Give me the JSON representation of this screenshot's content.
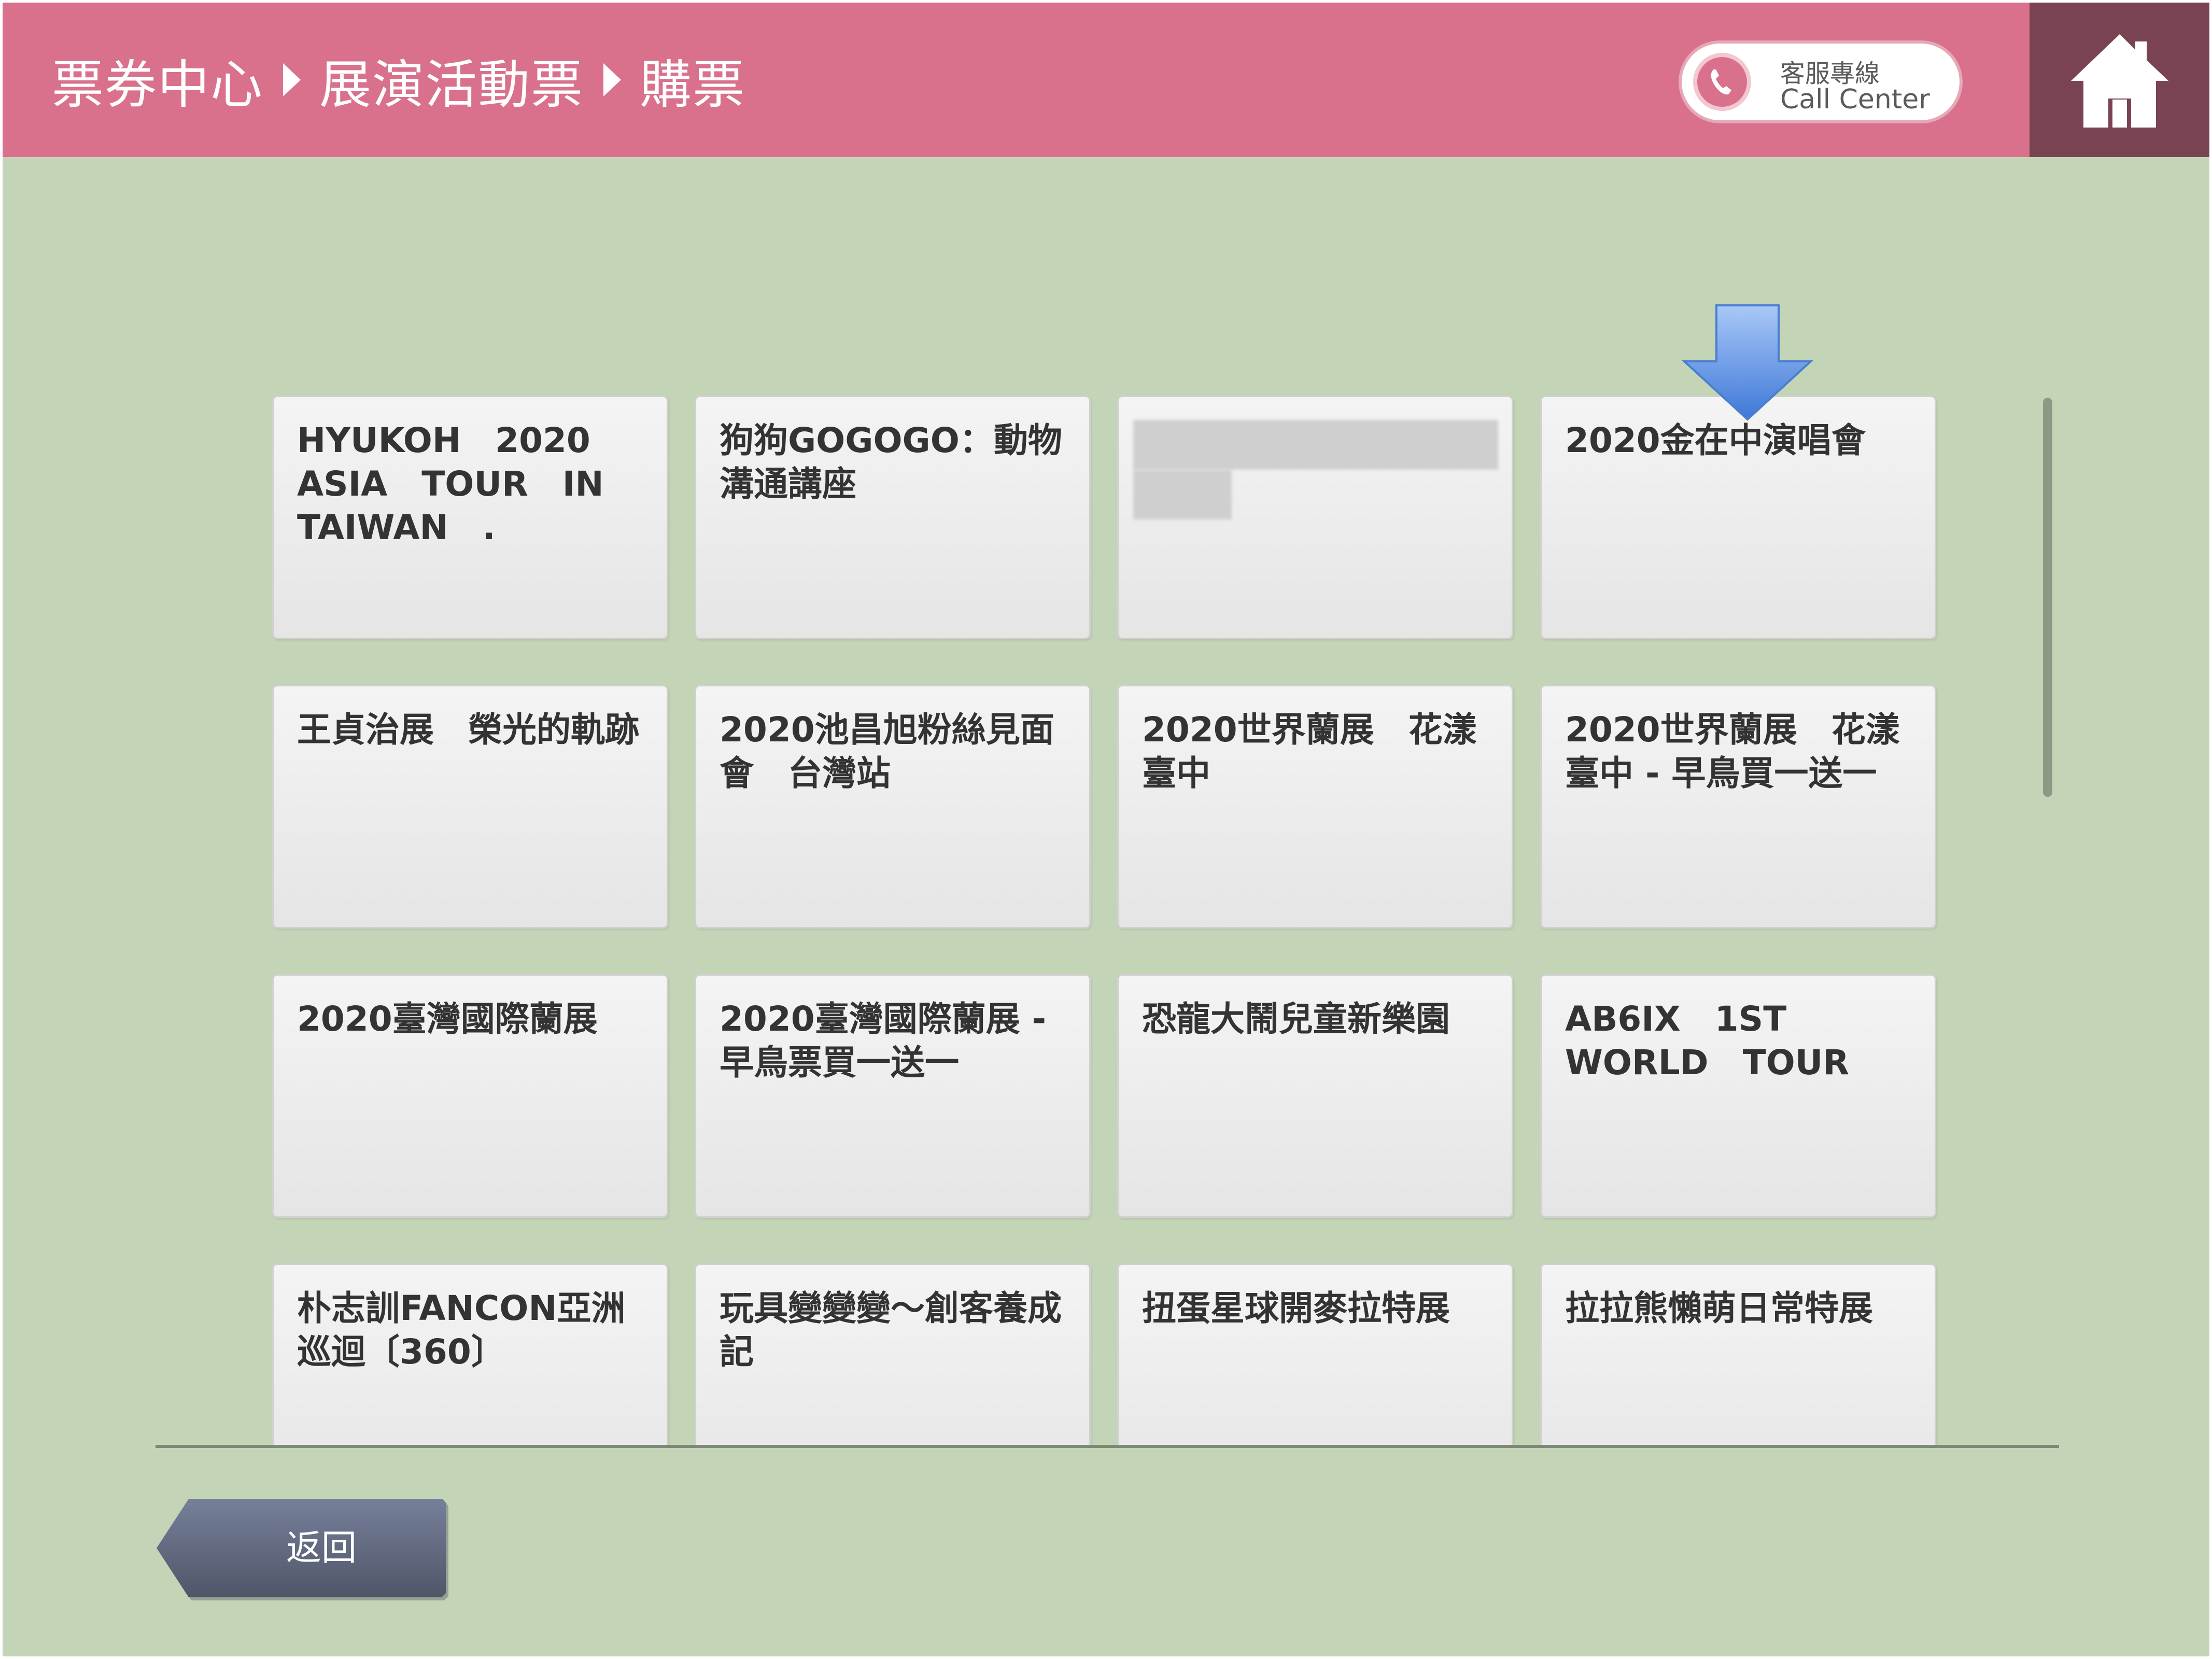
{
  "header": {
    "breadcrumb": [
      "票券中心",
      "展演活動票",
      "購票"
    ],
    "call_center": {
      "label_zh": "客服專線",
      "label_en": "Call Center",
      "icon": "phone-icon"
    },
    "home_icon": "home-icon"
  },
  "events": [
    {
      "label": "HYUKOH　2020 ASIA　TOUR　IN TAIWAN　."
    },
    {
      "label": "狗狗GOGOGO：動物溝通講座"
    },
    {
      "label": ""
    },
    {
      "label": "2020金在中演唱會"
    },
    {
      "label": "王貞治展　榮光的軌跡"
    },
    {
      "label": "2020池昌旭粉絲見面會　台灣站"
    },
    {
      "label": "2020世界蘭展　花漾臺中"
    },
    {
      "label": "2020世界蘭展　花漾臺中 - 早鳥買一送一"
    },
    {
      "label": "2020臺灣國際蘭展"
    },
    {
      "label": "2020臺灣國際蘭展 - 早鳥票買一送一"
    },
    {
      "label": "恐龍大鬧兒童新樂園"
    },
    {
      "label": "AB6IX　1ST WORLD　TOUR"
    },
    {
      "label": "朴志訓FANCON亞洲巡迴〔360〕"
    },
    {
      "label": "玩具變變變～創客養成記"
    },
    {
      "label": "扭蛋星球開麥拉特展"
    },
    {
      "label": "拉拉熊懶萌日常特展"
    }
  ],
  "back_button": {
    "label": "返回"
  },
  "colors": {
    "header": "#d9718c",
    "home_bg": "#7a4352",
    "page_bg": "#c4d5b7",
    "arrow": "#5b8de0",
    "back_button": "#5d6475"
  }
}
